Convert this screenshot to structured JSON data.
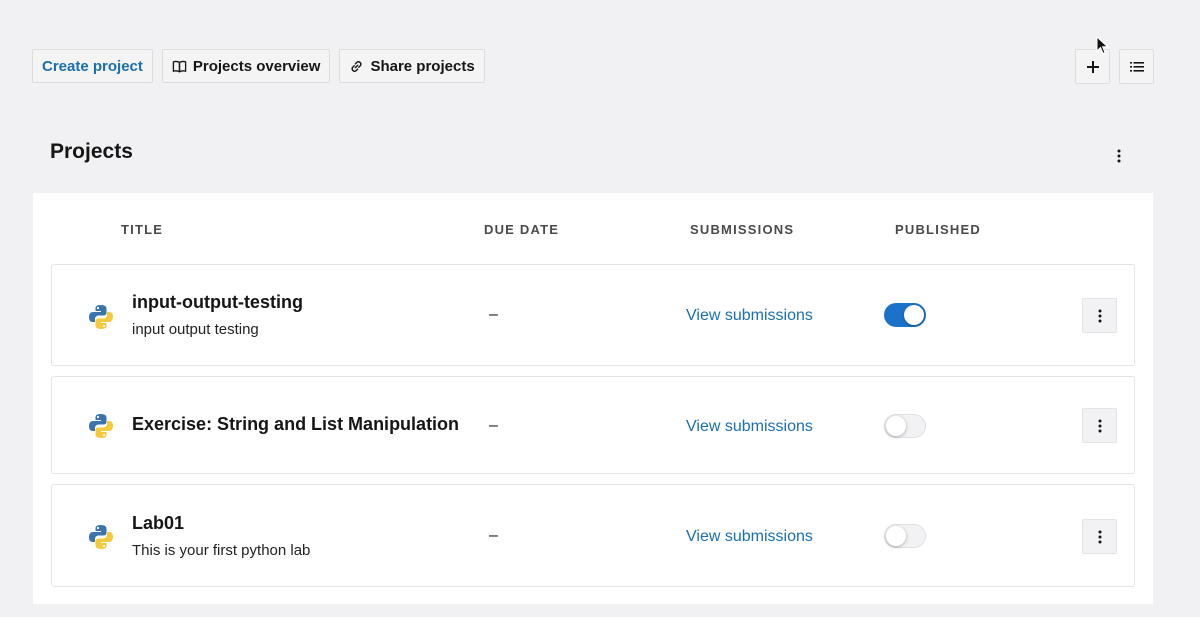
{
  "toolbar": {
    "create_project": "Create project",
    "projects_overview": "Projects overview",
    "share_projects": "Share projects"
  },
  "icons": {
    "overview": "book-icon",
    "share": "link-icon",
    "add": "plus-icon",
    "view": "list-view-icon",
    "more": "kebab-menu-icon",
    "language": "python-icon"
  },
  "page": {
    "title": "Projects"
  },
  "table": {
    "headers": {
      "title": "TITLE",
      "due_date": "DUE DATE",
      "submissions": "SUBMISSIONS",
      "published": "PUBLISHED"
    },
    "rows": [
      {
        "title": "input-output-testing",
        "description": "input output testing",
        "due_date": "–",
        "submissions_link": "View submissions",
        "published": true
      },
      {
        "title": "Exercise: String and List Manipulation",
        "description": "",
        "due_date": "–",
        "submissions_link": "View submissions",
        "published": false
      },
      {
        "title": "Lab01",
        "description": "This is your first python lab",
        "due_date": "–",
        "submissions_link": "View submissions",
        "published": false
      }
    ]
  },
  "colors": {
    "accent": "#1a6fb0",
    "toggle_on": "#1a73c8",
    "background": "#f1f1f3"
  }
}
